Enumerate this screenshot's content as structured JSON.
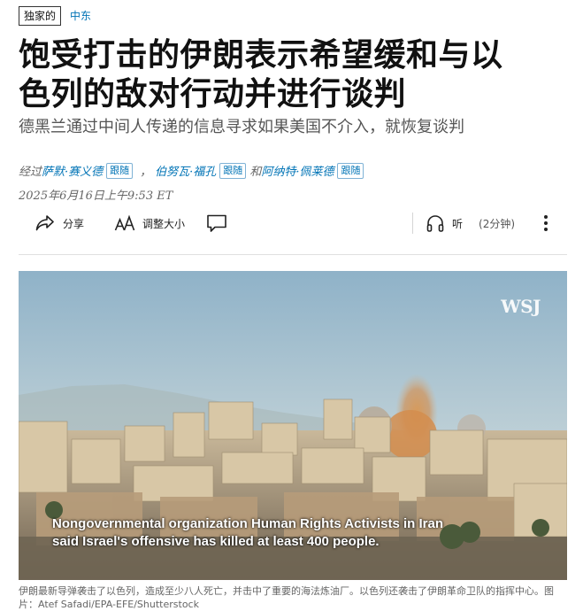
{
  "tags": {
    "exclusive": "独家的",
    "section": "中东"
  },
  "headline": {
    "line1": "饱受打击的伊朗表示希望缓和与以",
    "line2": "色列的敌对行动并进行谈判"
  },
  "dek": "德黑兰通过中间人传递的信息寻求如果美国不介入，就恢复谈判",
  "byline": {
    "prefix": "经过",
    "authors": [
      "萨默·赛义德",
      "伯努瓦·福孔",
      "阿纳特·佩莱德"
    ],
    "follow_label": "跟随",
    "separator": "，",
    "conjunction": "和"
  },
  "date": "2025年6月16日上午9:53 ET",
  "toolbar": {
    "share": "分享",
    "resize": "调整大小",
    "listen": "听",
    "listen_time": "(2分钟)"
  },
  "photo": {
    "logo": "WSJ",
    "overlay_line1": "Nongovernmental organization Human Rights Activists in Iran",
    "overlay_line2": "said Israel's offensive has killed at least 400 people."
  },
  "caption": "伊朗最新导弹袭击了以色列，造成至少八人死亡，并击中了重要的海法炼油厂。以色列还袭击了伊朗革命卫队的指挥中心。图片：Atef Safadi/EPA-EFE/Shutterstock",
  "colors": {
    "accent": "#0274b6",
    "text": "#111111",
    "muted": "#666666"
  }
}
